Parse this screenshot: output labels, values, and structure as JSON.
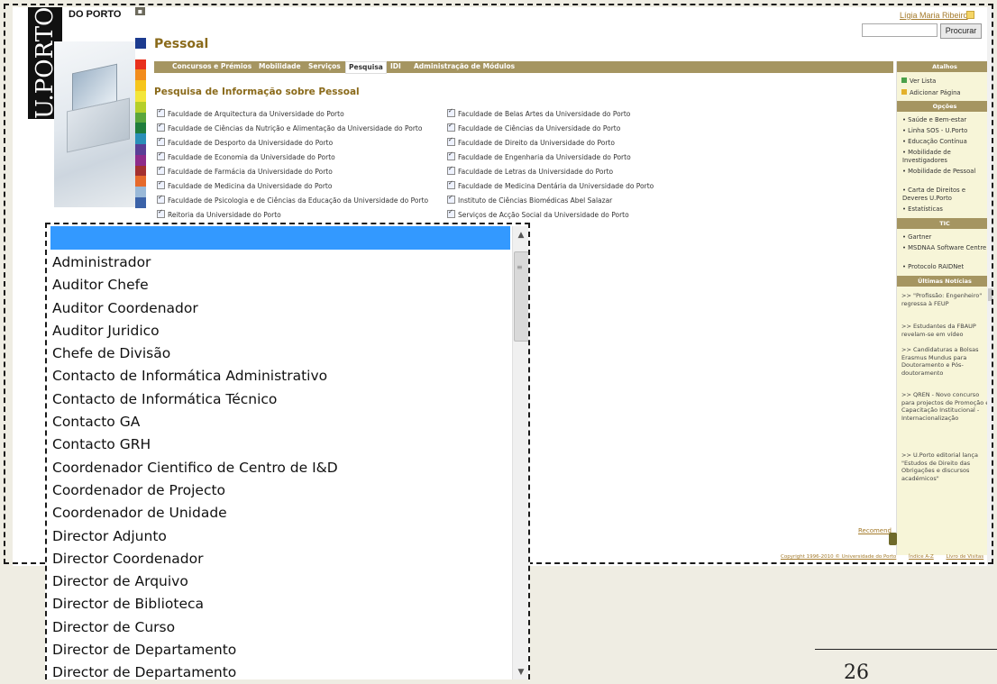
{
  "header": {
    "brand": "DO PORTO",
    "logo_text": "U.PORTO",
    "user_name": "Lígia Maria Ribeiro",
    "search_button": "Procurar",
    "search_value": ""
  },
  "section": {
    "title": "Pessoal",
    "tabs": [
      "Concursos e Prémios",
      "Mobilidade",
      "Serviços",
      "Pesquisa",
      "IDI",
      "Administração de Módulos"
    ],
    "active_tab": "Pesquisa",
    "search_heading": "Pesquisa de Informação sobre Pessoal"
  },
  "faculties": {
    "left": [
      "Faculdade de Arquitectura da Universidade do Porto",
      "Faculdade de Ciências da Nutrição e Alimentação da Universidade do Porto",
      "Faculdade de Desporto da Universidade do Porto",
      "Faculdade de Economia da Universidade do Porto",
      "Faculdade de Farmácia da Universidade do Porto",
      "Faculdade de Medicina da Universidade do Porto",
      "Faculdade de Psicologia e de Ciências da Educação da Universidade do Porto",
      "Reitoria da Universidade do Porto"
    ],
    "right": [
      "Faculdade de Belas Artes da Universidade do Porto",
      "Faculdade de Ciências da Universidade do Porto",
      "Faculdade de Direito da Universidade do Porto",
      "Faculdade de Engenharia da Universidade do Porto",
      "Faculdade de Letras da Universidade do Porto",
      "Faculdade de Medicina Dentária da Universidade do Porto",
      "Instituto de Ciências Biomédicas Abel Salazar",
      "Serviços de Acção Social da Universidade do Porto"
    ]
  },
  "sidebar": {
    "atalhos_title": "Atalhos",
    "atalhos": [
      "Ver Lista",
      "Adicionar Página"
    ],
    "opcoes_title": "Opções",
    "opcoes": [
      "Saúde e Bem-estar",
      "Linha SOS - U.Porto",
      "Educação Contínua",
      "Mobilidade de Investigadores",
      "Mobilidade de Pessoal",
      "Carta de Direitos e Deveres U.Porto",
      "Estatísticas"
    ],
    "tic_title": "TIC",
    "tic": [
      "Gartner",
      "MSDNAA Software Centre",
      "Protocolo RAIDNet"
    ],
    "news_title": "Últimas Notícias",
    "news": [
      ">> \"Profissão: Engenheiro\" regressa à FEUP",
      ">> Estudantes da FBAUP revelam-se em vídeo",
      ">> Candidaturas a Bolsas Erasmus Mundus para Doutoramento e Pós-doutoramento",
      ">> QREN - Novo concurso para projectos de Promoção e Capacitação Institucional - Internacionalização",
      ">> U.Porto editorial lança \"Estudos de Direito das Obrigações e discursos académicos\""
    ]
  },
  "footer": {
    "recommend": "Recomend",
    "links": [
      "Copyright 1996-2010 © Universidade do Porto",
      "Índice A-Z",
      "Livro de Visitas"
    ]
  },
  "dropdown": {
    "selected": "",
    "options": [
      "Administrador",
      "Auditor Chefe",
      "Auditor Coordenador",
      "Auditor Juridico",
      "Chefe de Divisão",
      "Contacto de Informática Administrativo",
      "Contacto de Informática Técnico",
      "Contacto GA",
      "Contacto GRH",
      "Coordenador Cientifico de Centro de I&D",
      "Coordenador de Projecto",
      "Coordenador de Unidade",
      "Director Adjunto",
      "Director Coordenador",
      "Director de Arquivo",
      "Director de Biblioteca",
      "Director de Curso",
      "Director de Departamento",
      "Director de Departamento"
    ]
  },
  "document": {
    "page_number": "26"
  },
  "colors": {
    "tab_bar": "#a59561",
    "title": "#8a6a1a",
    "highlight": "#3399ff",
    "sidebar_bg": "#f7f5d8"
  }
}
